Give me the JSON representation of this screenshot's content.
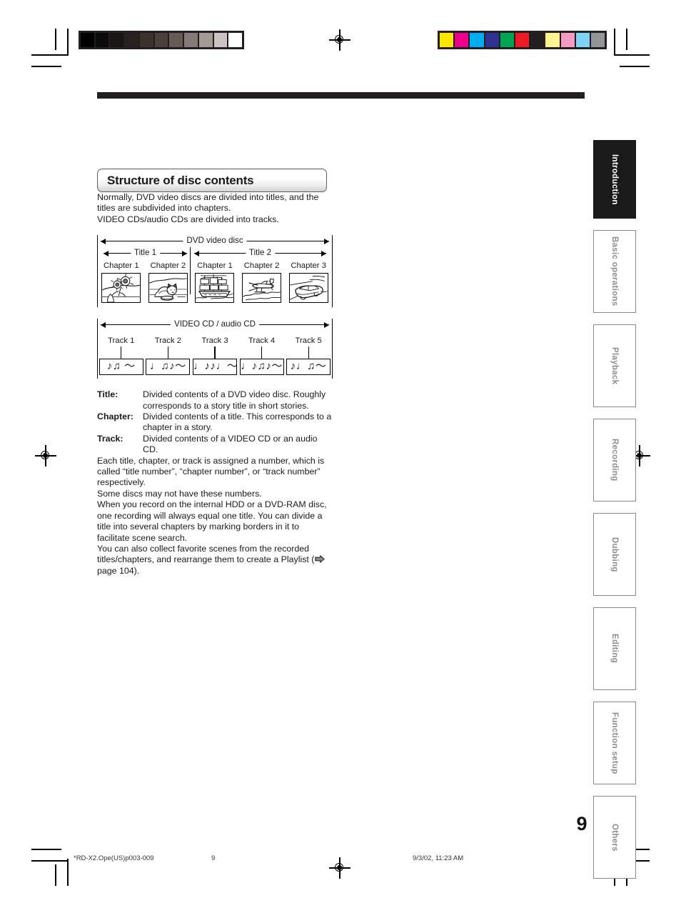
{
  "document": {
    "page_number": "9",
    "section_title": "Structure of disc contents"
  },
  "intro": {
    "line1": "Normally, DVD video discs are divided into titles, and the titles are subdivided into chapters.",
    "line2": "VIDEO CDs/audio CDs are divided into tracks."
  },
  "dvd_diagram": {
    "span_label": "DVD video disc",
    "titles": [
      {
        "label": "Title 1"
      },
      {
        "label": "Title 2"
      }
    ],
    "chapters": [
      {
        "label": "Chapter 1",
        "image": "sunflowers-thumbnail"
      },
      {
        "label": "Chapter 2",
        "image": "cat-thumbnail"
      },
      {
        "label": "Chapter 1",
        "image": "sailing-ship-thumbnail"
      },
      {
        "label": "Chapter 2",
        "image": "airplane-thumbnail"
      },
      {
        "label": "Chapter 3",
        "image": "car-thumbnail"
      }
    ]
  },
  "cd_diagram": {
    "span_label": "VIDEO CD / audio CD",
    "tracks": [
      {
        "label": "Track 1",
        "notes": "♪♫ ～"
      },
      {
        "label": "Track 2",
        "notes": "♩♫♪～"
      },
      {
        "label": "Track 3",
        "notes": "♩♪♪♩～"
      },
      {
        "label": "Track 4",
        "notes": "♩♪♫♪～"
      },
      {
        "label": "Track 5",
        "notes": "♪♩♫～"
      }
    ]
  },
  "definitions": [
    {
      "term": "Title:",
      "description": "Divided contents of a DVD video disc. Roughly corresponds to a story title in short stories."
    },
    {
      "term": "Chapter:",
      "description": "Divided contents of a title. This corresponds to a chapter in a story."
    },
    {
      "term": "Track:",
      "description": "Divided contents of a VIDEO CD or an audio CD."
    }
  ],
  "paragraphs": {
    "numbering_1": "Each title, chapter, or track is assigned a number, which is called “title number”, “chapter number”, or “track number” respectively.",
    "numbering_2": "Some discs may not have these numbers.",
    "recording_1": "When you record on the internal HDD or a DVD-RAM disc, one recording will always equal one title. You can divide a title into several chapters by marking borders in it to facilitate scene search.",
    "recording_2_before": "You can also collect favorite scenes from the recorded titles/chapters, and rearrange them to create a Playlist (",
    "recording_2_after": " page 104)."
  },
  "side_tabs": [
    {
      "label": "Introduction",
      "active": true
    },
    {
      "label": "Basic operations",
      "active": false
    },
    {
      "label": "Playback",
      "active": false
    },
    {
      "label": "Recording",
      "active": false
    },
    {
      "label": "Dubbing",
      "active": false
    },
    {
      "label": "Editing",
      "active": false
    },
    {
      "label": "Function setup",
      "active": false
    },
    {
      "label": "Others",
      "active": false
    }
  ],
  "footer": {
    "file_name": "*RD-X2.Ope(US)p003-009",
    "page": "9",
    "timestamp": "9/3/02, 11:23 AM"
  },
  "print_marks": {
    "grayscale_patches": [
      "#000000",
      "#0d0a0a",
      "#1b1616",
      "#2a2220",
      "#3b312d",
      "#4b403b",
      "#665a55",
      "#857a75",
      "#a39a96",
      "#cbc3c0",
      "#ffffff"
    ],
    "color_patches": [
      "#ffe600",
      "#ec008c",
      "#00aeef",
      "#2e3192",
      "#00a551",
      "#ed1c24",
      "#231f20",
      "#fdf291",
      "#f59ac4",
      "#7fd4f5",
      "#939598"
    ]
  }
}
